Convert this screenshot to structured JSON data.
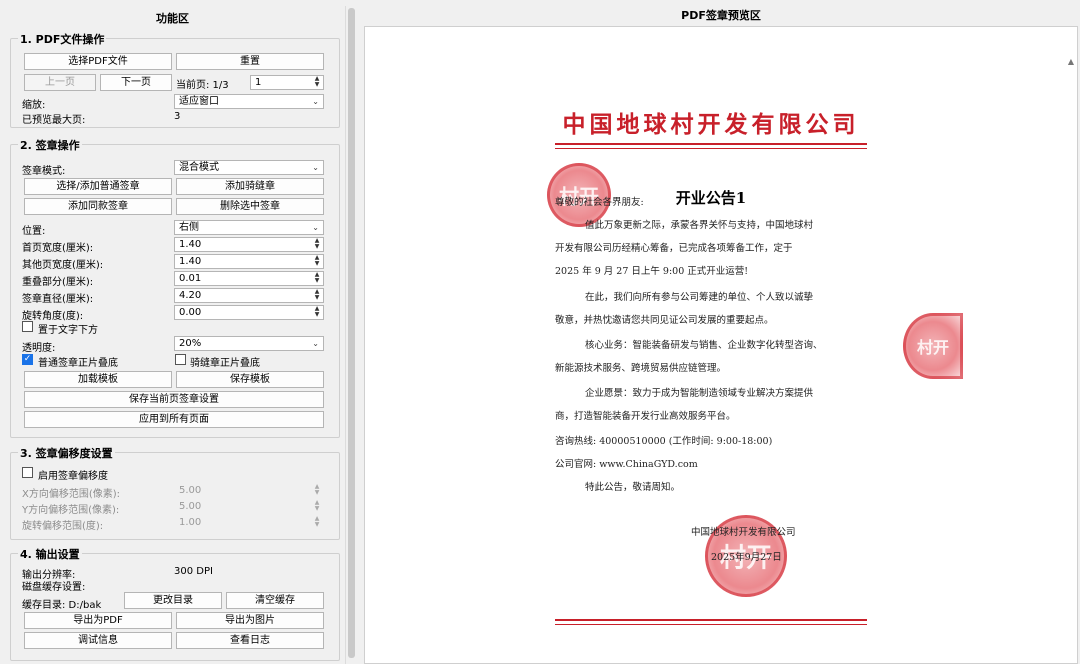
{
  "left_panel": {
    "title": "功能区",
    "section1": {
      "title": "1. PDF文件操作",
      "select_pdf": "选择PDF文件",
      "reset": "重置",
      "prev_page": "上一页",
      "next_page": "下一页",
      "current_page_label": "当前页: 1/3",
      "page_input": "1",
      "zoom_label": "缩放:",
      "zoom_value": "适应窗口",
      "max_preview_label": "已预览最大页:",
      "max_preview_value": "3"
    },
    "section2": {
      "title": "2. 签章操作",
      "mode_label": "签章模式:",
      "mode_value": "混合模式",
      "select_add_normal": "选择/添加普通签章",
      "add_seam": "添加骑缝章",
      "add_same": "添加同款签章",
      "delete_selected": "删除选中签章",
      "position_label": "位置:",
      "position_value": "右侧",
      "first_width_label": "首页宽度(厘米):",
      "first_width_value": "1.40",
      "other_width_label": "其他页宽度(厘米):",
      "other_width_value": "1.40",
      "overlap_label": "重叠部分(厘米):",
      "overlap_value": "0.01",
      "diameter_label": "签章直径(厘米):",
      "diameter_value": "4.20",
      "rotation_label": "旋转角度(度):",
      "rotation_value": "0.00",
      "below_text_label": "置于文字下方",
      "below_text_checked": false,
      "opacity_label": "透明度:",
      "opacity_value": "20%",
      "normal_multiply_label": "普通签章正片叠底",
      "normal_multiply_checked": true,
      "seam_multiply_label": "骑缝章正片叠底",
      "seam_multiply_checked": false,
      "load_template": "加载模板",
      "save_template": "保存模板",
      "save_current": "保存当前页签章设置",
      "apply_all": "应用到所有页面"
    },
    "section3": {
      "title": "3. 签章偏移度设置",
      "enable_label": "启用签章偏移度",
      "enable_checked": false,
      "x_label": "X方向偏移范围(像素):",
      "x_value": "5.00",
      "y_label": "Y方向偏移范围(像素):",
      "y_value": "5.00",
      "rot_label": "旋转偏移范围(度):",
      "rot_value": "1.00"
    },
    "section4": {
      "title": "4. 输出设置",
      "dpi_label": "输出分辨率:",
      "dpi_value": "300 DPI",
      "cache_label": "磁盘缓存设置:",
      "cache_dir_label": "缓存目录: D:/bak",
      "change_dir": "更改目录",
      "clear_cache": "清空缓存",
      "export_pdf": "导出为PDF",
      "export_image": "导出为图片",
      "debug_info": "调试信息",
      "view_log": "查看日志"
    }
  },
  "preview": {
    "title": "PDF签章预览区",
    "company": "中国地球村开发有限公司",
    "doc_title": "开业公告1",
    "lines": [
      "尊敬的社会各界朋友:",
      "值此万象更新之际，承蒙各界关怀与支持，中国地球村",
      "开发有限公司历经精心筹备，已完成各项筹备工作，定于",
      "2025 年 9 月 27 日上午 9:00 正式开业运营!",
      "在此，我们向所有参与公司筹建的单位、个人致以诚挚",
      "敬意，并热忱邀请您共同见证公司发展的重要起点。",
      "核心业务：智能装备研发与销售、企业数字化转型咨询、",
      "新能源技术服务、跨境贸易供应链管理。",
      "企业愿景：致力于成为智能制造领域专业解决方案提供",
      "商，打造智能装备开发行业高效服务平台。",
      "咨询热线: 40000510000 (工作时间: 9:00-18:00)",
      "公司官网: www.ChinaGYD.com",
      "特此公告，敬请周知。"
    ],
    "signature_company": "中国地球村开发有限公司",
    "signature_date": "2025年9月27日",
    "seal_text": "村开"
  }
}
